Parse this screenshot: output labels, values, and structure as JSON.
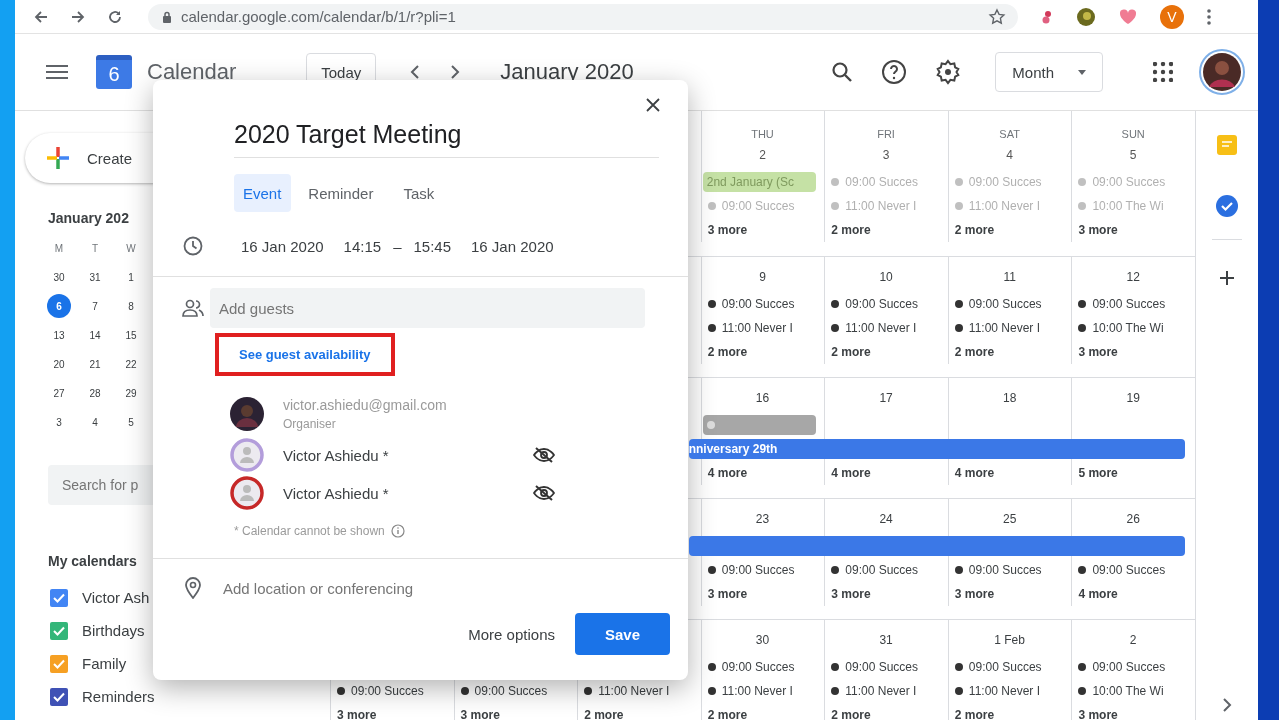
{
  "browser": {
    "url": "calendar.google.com/calendar/b/1/r?pli=1",
    "profile_initial": "V"
  },
  "header": {
    "logo_day": "6",
    "app_name": "Calendar",
    "today_button": "Today",
    "period": "January 2020",
    "view": "Month"
  },
  "sidebar": {
    "create": "Create",
    "mini_calendar": {
      "title": "January 202",
      "weekdays": [
        "M",
        "T",
        "W"
      ],
      "weeks": [
        [
          {
            "day": "30",
            "selected": false
          },
          {
            "day": "31",
            "selected": false
          },
          {
            "day": "1",
            "selected": false
          }
        ],
        [
          {
            "day": "6",
            "selected": true
          },
          {
            "day": "7",
            "selected": false
          },
          {
            "day": "8",
            "selected": false
          }
        ],
        [
          {
            "day": "13",
            "selected": false
          },
          {
            "day": "14",
            "selected": false
          },
          {
            "day": "15",
            "selected": false
          }
        ],
        [
          {
            "day": "20",
            "selected": false
          },
          {
            "day": "21",
            "selected": false
          },
          {
            "day": "22",
            "selected": false
          }
        ],
        [
          {
            "day": "27",
            "selected": false
          },
          {
            "day": "28",
            "selected": false
          },
          {
            "day": "29",
            "selected": false
          }
        ],
        [
          {
            "day": "3",
            "selected": false
          },
          {
            "day": "4",
            "selected": false
          },
          {
            "day": "5",
            "selected": false
          }
        ]
      ]
    },
    "search": {
      "placeholder": "Search for p"
    },
    "my_calendars": {
      "heading": "My calendars",
      "items": [
        {
          "label": "Victor Ash",
          "checked": true,
          "color": "#4285f4"
        },
        {
          "label": "Birthdays",
          "checked": true,
          "color": "#33b679"
        },
        {
          "label": "Family",
          "checked": true,
          "color": "#f6a023"
        },
        {
          "label": "Reminders",
          "checked": true,
          "color": "#3f51b5"
        }
      ]
    }
  },
  "month_grid": {
    "weeks": [
      {
        "cells": [
          {},
          {},
          {},
          {
            "weekday": "THU",
            "date": "2",
            "past": true,
            "items": [
              {
                "kind": "chip",
                "text": "2nd January (Sc",
                "color": "#c5e1a5"
              },
              {
                "kind": "dot",
                "text": "09:00 Succes"
              },
              {
                "kind": "more",
                "text": "3 more"
              }
            ]
          },
          {
            "weekday": "FRI",
            "date": "3",
            "past": true,
            "items": [
              {
                "kind": "dot",
                "text": "09:00 Succes"
              },
              {
                "kind": "dot",
                "text": "11:00 Never I"
              },
              {
                "kind": "more",
                "text": "2 more"
              }
            ]
          },
          {
            "weekday": "SAT",
            "date": "4",
            "past": true,
            "items": [
              {
                "kind": "dot",
                "text": "09:00 Succes"
              },
              {
                "kind": "dot",
                "text": "11:00 Never I"
              },
              {
                "kind": "more",
                "text": "2 more"
              }
            ]
          },
          {
            "weekday": "SUN",
            "date": "5",
            "past": true,
            "items": [
              {
                "kind": "dot",
                "text": "09:00 Succes"
              },
              {
                "kind": "dot",
                "text": "10:00 The Wi"
              },
              {
                "kind": "more",
                "text": "3 more"
              }
            ]
          }
        ]
      },
      {
        "cells": [
          {},
          {},
          {},
          {
            "date": "9",
            "past": false,
            "items": [
              {
                "kind": "dot",
                "text": "09:00 Succes"
              },
              {
                "kind": "dot",
                "text": "11:00 Never I"
              },
              {
                "kind": "more",
                "text": "2 more"
              }
            ]
          },
          {
            "date": "10",
            "past": false,
            "items": [
              {
                "kind": "dot",
                "text": "09:00 Succes"
              },
              {
                "kind": "dot",
                "text": "11:00 Never I"
              },
              {
                "kind": "more",
                "text": "2 more"
              }
            ]
          },
          {
            "date": "11",
            "past": false,
            "items": [
              {
                "kind": "dot",
                "text": "09:00 Succes"
              },
              {
                "kind": "dot",
                "text": "11:00 Never I"
              },
              {
                "kind": "more",
                "text": "2 more"
              }
            ]
          },
          {
            "date": "12",
            "past": false,
            "items": [
              {
                "kind": "dot",
                "text": "09:00 Succes"
              },
              {
                "kind": "dot",
                "text": "10:00 The Wi"
              },
              {
                "kind": "more",
                "text": "3 more"
              }
            ]
          }
        ]
      },
      {
        "cells": [
          {},
          {},
          {},
          {
            "date": "16",
            "past": false,
            "items": [
              {
                "kind": "chip",
                "color": "#a7a7a7"
              },
              {
                "kind": "banner",
                "text": "nniversary 29th",
                "color": "#3b78e7"
              },
              {
                "kind": "more",
                "text": "4 more"
              }
            ]
          },
          {
            "date": "17",
            "past": false,
            "items": [
              {
                "kind": "blank"
              },
              {
                "kind": "blank"
              },
              {
                "kind": "more",
                "text": "4 more"
              }
            ]
          },
          {
            "date": "18",
            "past": false,
            "items": [
              {
                "kind": "blank"
              },
              {
                "kind": "blank"
              },
              {
                "kind": "more",
                "text": "4 more"
              }
            ]
          },
          {
            "date": "19",
            "past": false,
            "items": [
              {
                "kind": "blank"
              },
              {
                "kind": "blank"
              },
              {
                "kind": "more",
                "text": "5 more"
              }
            ]
          }
        ]
      },
      {
        "cells": [
          {},
          {},
          {},
          {
            "date": "23",
            "past": false,
            "items": [
              {
                "kind": "banner",
                "color": "#3b78e7"
              },
              {
                "kind": "dot",
                "text": "09:00 Succes"
              },
              {
                "kind": "more",
                "text": "3 more"
              }
            ]
          },
          {
            "date": "24",
            "past": false,
            "items": [
              {
                "kind": "blank"
              },
              {
                "kind": "dot",
                "text": "09:00 Succes"
              },
              {
                "kind": "more",
                "text": "3 more"
              }
            ]
          },
          {
            "date": "25",
            "past": false,
            "items": [
              {
                "kind": "blank"
              },
              {
                "kind": "dot",
                "text": "09:00 Succes"
              },
              {
                "kind": "more",
                "text": "3 more"
              }
            ]
          },
          {
            "date": "26",
            "past": false,
            "items": [
              {
                "kind": "blank"
              },
              {
                "kind": "dot",
                "text": "09:00 Succes"
              },
              {
                "kind": "more",
                "text": "4 more"
              }
            ]
          }
        ]
      },
      {
        "cells": [
          {
            "past": false,
            "items": [
              {
                "kind": "blank"
              },
              {
                "kind": "dot",
                "text": "09:00 Succes"
              },
              {
                "kind": "more",
                "text": "3 more"
              }
            ]
          },
          {
            "past": false,
            "items": [
              {
                "kind": "blank"
              },
              {
                "kind": "dot",
                "text": "09:00 Succes"
              },
              {
                "kind": "more",
                "text": "3 more"
              }
            ]
          },
          {
            "past": false,
            "items": [
              {
                "kind": "blank"
              },
              {
                "kind": "dot",
                "text": "11:00 Never I"
              },
              {
                "kind": "more",
                "text": "2 more"
              }
            ]
          },
          {
            "date": "30",
            "past": false,
            "items": [
              {
                "kind": "dot",
                "text": "09:00 Succes"
              },
              {
                "kind": "dot",
                "text": "11:00 Never I"
              },
              {
                "kind": "more",
                "text": "2 more"
              }
            ]
          },
          {
            "date": "31",
            "past": false,
            "items": [
              {
                "kind": "dot",
                "text": "09:00 Succes"
              },
              {
                "kind": "dot",
                "text": "11:00 Never I"
              },
              {
                "kind": "more",
                "text": "2 more"
              }
            ]
          },
          {
            "date": "1 Feb",
            "past": false,
            "items": [
              {
                "kind": "dot",
                "text": "09:00 Succes"
              },
              {
                "kind": "dot",
                "text": "11:00 Never I"
              },
              {
                "kind": "more",
                "text": "2 more"
              }
            ]
          },
          {
            "date": "2",
            "past": false,
            "items": [
              {
                "kind": "dot",
                "text": "09:00 Succes"
              },
              {
                "kind": "dot",
                "text": "10:00 The Wi"
              },
              {
                "kind": "more",
                "text": "3 more"
              }
            ]
          }
        ]
      }
    ]
  },
  "event_dialog": {
    "title": "2020 Target Meeting",
    "tabs": [
      {
        "label": "Event",
        "selected": true
      },
      {
        "label": "Reminder",
        "selected": false
      },
      {
        "label": "Task",
        "selected": false
      }
    ],
    "start_date": "16 Jan 2020",
    "start_time": "14:15",
    "separator": "–",
    "end_time": "15:45",
    "end_date": "16 Jan 2020",
    "guests_field": {
      "placeholder": "Add guests"
    },
    "availability_link": {
      "text": "See guest availability",
      "highlighted": true
    },
    "organiser": {
      "email": "victor.ashiedu@gmail.com",
      "role": "Organiser"
    },
    "guests": [
      {
        "name": "Victor Ashiedu *",
        "color": "#b39ddb"
      },
      {
        "name": "Victor Ashiedu *",
        "color": "#c62828"
      }
    ],
    "note": "* Calendar cannot be shown",
    "location_field": {
      "placeholder": "Add location or conferencing"
    },
    "more_options": "More options",
    "save": "Save"
  }
}
